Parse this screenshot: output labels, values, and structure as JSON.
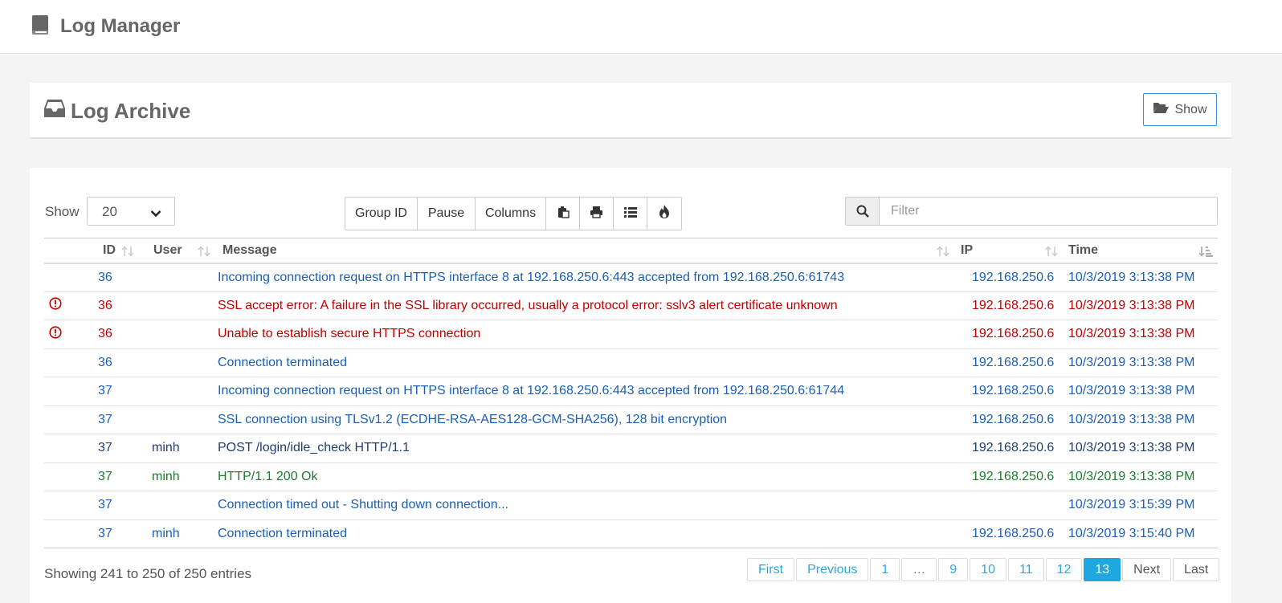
{
  "header": {
    "title": "Log Manager"
  },
  "archive": {
    "title": "Log Archive",
    "show_label": "Show"
  },
  "length": {
    "label": "Show",
    "value": "20"
  },
  "toolbar": {
    "group_id": "Group ID",
    "pause": "Pause",
    "columns": "Columns"
  },
  "filter": {
    "placeholder": "Filter"
  },
  "columns": {
    "id": "ID",
    "user": "User",
    "message": "Message",
    "ip": "IP",
    "time": "Time"
  },
  "colors": {
    "info": "#1a5fb4",
    "error": "#c00000",
    "success": "#1e7b2e",
    "dark": "#1f3d6e"
  },
  "rows": [
    {
      "level": "info",
      "icon": false,
      "id": "36",
      "user": "",
      "message": "Incoming connection request on HTTPS interface 8 at 192.168.250.6:443 accepted from 192.168.250.6:61743",
      "ip": "192.168.250.6",
      "time": "10/3/2019 3:13:38 PM"
    },
    {
      "level": "error",
      "icon": true,
      "id": "36",
      "user": "",
      "message": "SSL accept error: A failure in the SSL library occurred, usually a protocol error: sslv3 alert certificate unknown",
      "ip": "192.168.250.6",
      "time": "10/3/2019 3:13:38 PM"
    },
    {
      "level": "error",
      "icon": true,
      "id": "36",
      "user": "",
      "message": "Unable to establish secure HTTPS connection",
      "ip": "192.168.250.6",
      "time": "10/3/2019 3:13:38 PM"
    },
    {
      "level": "info",
      "icon": false,
      "id": "36",
      "user": "",
      "message": "Connection terminated",
      "ip": "192.168.250.6",
      "time": "10/3/2019 3:13:38 PM"
    },
    {
      "level": "info",
      "icon": false,
      "id": "37",
      "user": "",
      "message": "Incoming connection request on HTTPS interface 8 at 192.168.250.6:443 accepted from 192.168.250.6:61744",
      "ip": "192.168.250.6",
      "time": "10/3/2019 3:13:38 PM"
    },
    {
      "level": "info",
      "icon": false,
      "id": "37",
      "user": "",
      "message": "SSL connection using TLSv1.2 (ECDHE-RSA-AES128-GCM-SHA256), 128 bit encryption",
      "ip": "192.168.250.6",
      "time": "10/3/2019 3:13:38 PM"
    },
    {
      "level": "dark",
      "icon": false,
      "id": "37",
      "user": "minh",
      "message": "POST /login/idle_check HTTP/1.1",
      "ip": "192.168.250.6",
      "time": "10/3/2019 3:13:38 PM"
    },
    {
      "level": "success",
      "icon": false,
      "id": "37",
      "user": "minh",
      "message": "HTTP/1.1 200 Ok",
      "ip": "192.168.250.6",
      "time": "10/3/2019 3:13:38 PM"
    },
    {
      "level": "info",
      "icon": false,
      "id": "37",
      "user": "",
      "message": "Connection timed out - Shutting down connection...",
      "ip": "",
      "time": "10/3/2019 3:15:39 PM"
    },
    {
      "level": "info",
      "icon": false,
      "id": "37",
      "user": "minh",
      "message": "Connection terminated",
      "ip": "192.168.250.6",
      "time": "10/3/2019 3:15:40 PM"
    }
  ],
  "info": "Showing 241 to 250 of 250 entries",
  "pagination": {
    "items": [
      {
        "label": "First",
        "state": "link"
      },
      {
        "label": "Previous",
        "state": "link"
      },
      {
        "label": "1",
        "state": "link"
      },
      {
        "label": "…",
        "state": "ellipsis"
      },
      {
        "label": "9",
        "state": "link"
      },
      {
        "label": "10",
        "state": "link"
      },
      {
        "label": "11",
        "state": "link"
      },
      {
        "label": "12",
        "state": "link"
      },
      {
        "label": "13",
        "state": "active"
      },
      {
        "label": "Next",
        "state": "disabled"
      },
      {
        "label": "Last",
        "state": "disabled"
      }
    ]
  }
}
